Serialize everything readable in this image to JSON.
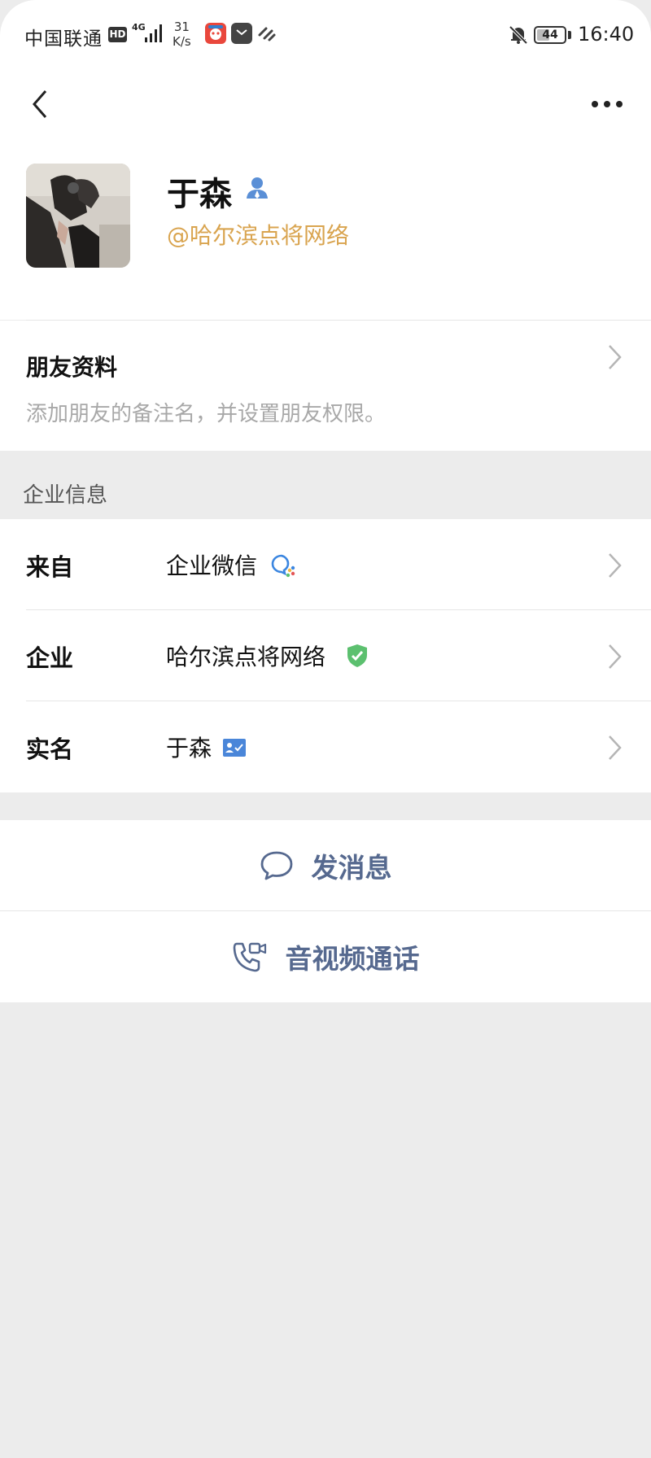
{
  "status_bar": {
    "carrier": "中国联通",
    "hd_badge": "HD",
    "network": "4G",
    "speed_value": "31",
    "speed_unit": "K/s",
    "battery": "44",
    "time": "16:40"
  },
  "nav": {
    "back_icon": "chevron-left-icon",
    "more_icon": "more-dots-icon"
  },
  "profile": {
    "name": "于森",
    "name_badge_icon": "person-icon",
    "corp_tag": "@哈尔滨点将网络"
  },
  "friend_info": {
    "title": "朋友资料",
    "subtitle": "添加朋友的备注名，并设置朋友权限。"
  },
  "section_header": "企业信息",
  "info_rows": [
    {
      "label": "来自",
      "value": "企业微信",
      "icon": "wecom-icon"
    },
    {
      "label": "企业",
      "value": "哈尔滨点将网络",
      "icon": "verified-shield-icon"
    },
    {
      "label": "实名",
      "value": "于森",
      "icon": "id-card-icon"
    }
  ],
  "actions": [
    {
      "label": "发消息",
      "icon": "chat-bubble-icon"
    },
    {
      "label": "音视频通话",
      "icon": "phone-video-icon"
    }
  ],
  "colors": {
    "accent_text": "#56698f",
    "corp_tag": "#d9a44f",
    "verified_green": "#5cc06f",
    "badge_blue": "#4a86d9",
    "background": "#ececec"
  }
}
